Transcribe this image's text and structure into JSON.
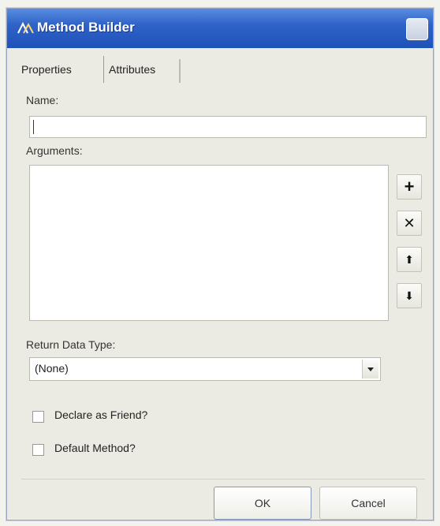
{
  "window": {
    "title": "Method Builder"
  },
  "tabs": [
    {
      "label": "Properties"
    },
    {
      "label": "Attributes"
    }
  ],
  "fields": {
    "name_label": "Name:",
    "name_value": "",
    "arguments_label": "Arguments:",
    "return_type_label": "Return Data Type:",
    "return_type_value": "(None)"
  },
  "argument_buttons": {
    "add": "+",
    "remove": "✕",
    "move_up": "⬆",
    "move_down": "⬇"
  },
  "checkboxes": [
    {
      "label": "Declare as Friend?",
      "checked": false
    },
    {
      "label": "Default Method?",
      "checked": false
    }
  ],
  "buttons": {
    "ok": "OK",
    "cancel": "Cancel"
  },
  "colors": {
    "titlebar": "#2f63c8",
    "dialog_bg": "#ecebe3"
  }
}
